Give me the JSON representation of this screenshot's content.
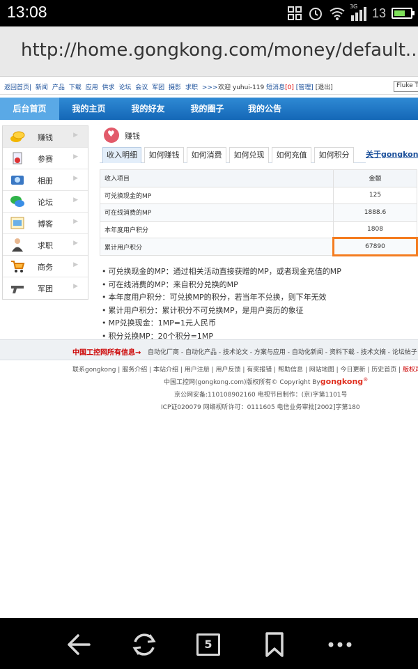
{
  "status": {
    "time": "13:08",
    "net": "3G",
    "battery_num": "13",
    "battery_level": 0.7
  },
  "browser": {
    "url": "http://home.gongkong.com/money/default..."
  },
  "topnav": {
    "links": [
      "返回首页|",
      "新闻",
      "产品",
      "下载",
      "应用",
      "供求",
      "论坛",
      "会议",
      "军团",
      "摄影",
      "求职",
      ">>>"
    ],
    "welcome": "欢迎",
    "username": "yuhui-119",
    "msg_label": "短消息",
    "msg_count": "[0]",
    "manage": "[管理]",
    "logout": "[退出]",
    "search_value": "Fluke Ti"
  },
  "mainnav": {
    "items": [
      "后台首页",
      "我的主页",
      "我的好友",
      "我的圈子",
      "我的公告"
    ]
  },
  "sidebar": {
    "items": [
      {
        "label": "赚钱",
        "icon": "coins-icon"
      },
      {
        "label": "参赛",
        "icon": "contest-icon"
      },
      {
        "label": "相册",
        "icon": "photo-album-icon"
      },
      {
        "label": "论坛",
        "icon": "forum-icon"
      },
      {
        "label": "博客",
        "icon": "blog-icon"
      },
      {
        "label": "求职",
        "icon": "job-icon"
      },
      {
        "label": "商务",
        "icon": "shopping-cart-icon"
      },
      {
        "label": "军团",
        "icon": "gun-icon"
      }
    ]
  },
  "content": {
    "title": "赚钱",
    "tabs": [
      "收入明细",
      "如何赚钱",
      "如何消费",
      "如何兑现",
      "如何充值",
      "如何积分"
    ],
    "tab_link": "关于gongkongM",
    "table": {
      "headers": [
        "收入项目",
        "金额"
      ],
      "rows": [
        [
          "可兑换现金的MP",
          "125"
        ],
        [
          "可在线消费的MP",
          "1888.6"
        ],
        [
          "本年度用户积分",
          "1808"
        ],
        [
          "累计用户积分",
          "67890"
        ]
      ]
    },
    "notes": [
      "可兑换现金的MP：通过相关活动直接获赠的MP，或者现金充值的MP",
      "可在线消费的MP：来自积分兑换的MP",
      "本年度用户积分：可兑换MP的积分，若当年不兑换，则下年无效",
      "累计用户积分：累计积分不可兑换MP，是用户资历的象征",
      "MP兑换现金：1MP=1元人民币",
      "积分兑换MP：20个积分=1MP"
    ]
  },
  "footer": {
    "red": "中国工控网所有信息→",
    "links": "自动化厂商 - 自动化产品 - 技术论文 - 方案与应用 - 自动化新闻 - 资料下载 - 技术文摘 - 论坛帖子 -",
    "line1": "联系gongkong | 服务介绍 | 本站介绍 | 用户注册 | 用户反馈 | 有奖报错 | 帮助信息 | 网站地图 | 今日更新 | 历史首页 |",
    "line1_red": "版权声明",
    "line2": "中国工控网(gongkong.com)版权所有© Copyright By",
    "brand": "gongkong",
    "line3": "京公网安备:110108902160   电视节目制作：(京)字第1101号",
    "line4": "ICP证020079   网络视听许可：0111605   电信业务审批[2002]字第180"
  },
  "bottombar": {
    "tabs_count": "5"
  }
}
